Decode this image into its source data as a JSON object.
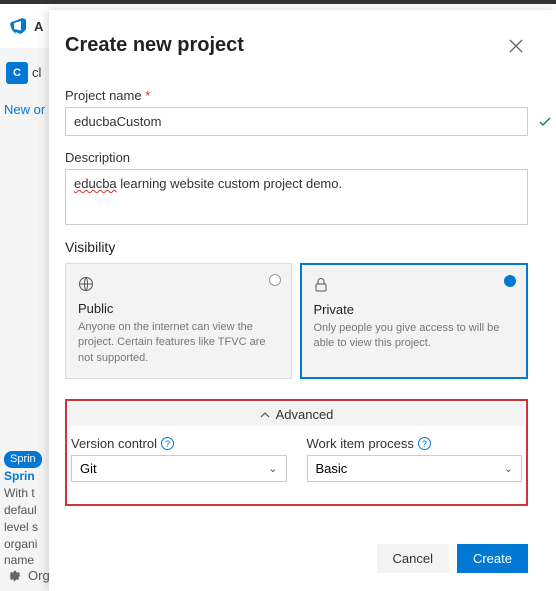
{
  "background": {
    "app_initial": "A",
    "tab_letter": "C",
    "tab_text": "cl",
    "new_org": "New or",
    "badge": "Sprin",
    "heading": "Sprin",
    "lines": [
      "With t",
      "defaul",
      "level s",
      "organi",
      "name"
    ],
    "org_settings": "Org"
  },
  "modal": {
    "title": "Create new project",
    "project_name": {
      "label": "Project name",
      "required": "*",
      "value": "educbaCustom"
    },
    "description": {
      "label": "Description",
      "value_wavy": "educba",
      "value_rest": " learning website custom project demo."
    },
    "visibility": {
      "label": "Visibility",
      "public": {
        "title": "Public",
        "desc": "Anyone on the internet can view the project. Certain features like TFVC are not supported."
      },
      "private": {
        "title": "Private",
        "desc": "Only people you give access to will be able to view this project."
      }
    },
    "advanced": {
      "label": "Advanced",
      "version_control": {
        "label": "Version control",
        "value": "Git"
      },
      "work_item": {
        "label": "Work item process",
        "value": "Basic"
      }
    },
    "footer": {
      "cancel": "Cancel",
      "create": "Create"
    }
  }
}
